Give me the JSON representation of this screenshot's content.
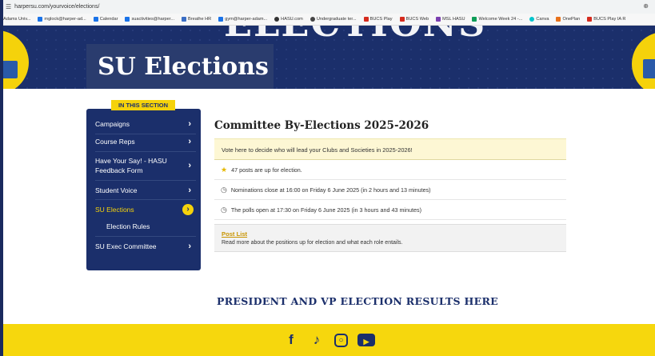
{
  "browser": {
    "url": "harpersu.com/yourvoice/elections/",
    "bookmarks": [
      {
        "label": "Adams Univ...",
        "color": "#1b5fa8"
      },
      {
        "label": "mglock@harper-ad...",
        "color": "#1a73e8"
      },
      {
        "label": "Calendar",
        "color": "#1a73e8"
      },
      {
        "label": "suactivities@harper...",
        "color": "#1a73e8"
      },
      {
        "label": "Breathe HR",
        "color": "#3b6ec4"
      },
      {
        "label": "gym@harper-adam...",
        "color": "#1a73e8"
      },
      {
        "label": "HASU.com",
        "color": "#333333"
      },
      {
        "label": "Undergraduate ter...",
        "color": "#444444"
      },
      {
        "label": "BUCS Play",
        "color": "#d52b1e"
      },
      {
        "label": "BUCS Web",
        "color": "#d52b1e"
      },
      {
        "label": "MSL HASU",
        "color": "#7a3fb0"
      },
      {
        "label": "Welcome Week 24 -...",
        "color": "#0f9d58"
      },
      {
        "label": "Canva",
        "color": "#00c4cc"
      },
      {
        "label": "OnePlan",
        "color": "#e8711a"
      },
      {
        "label": "BUCS Play IA R",
        "color": "#d52b1e"
      }
    ]
  },
  "banner": {
    "page_title": "SU Elections",
    "background_word": "ELECTIONS"
  },
  "sidebar": {
    "heading": "IN THIS SECTION",
    "items": [
      {
        "label": "Campaigns"
      },
      {
        "label": "Course Reps"
      },
      {
        "label": "Have Your Say! - HASU"
      },
      {
        "label": "Feedback Form"
      },
      {
        "label": "Student Voice"
      },
      {
        "label": "SU Elections"
      },
      {
        "label": "Election Rules"
      },
      {
        "label": "SU Exec Committee"
      }
    ]
  },
  "main": {
    "heading": "Committee By-Elections 2025-2026",
    "notice": "Vote here to decide who will lead your Clubs and Societies in 2025-2026!",
    "info": [
      {
        "icon": "star-icon",
        "text": "47 posts are up for election."
      },
      {
        "icon": "clock-icon",
        "text": "Nominations close at 16:00 on Friday 6 June 2025 (in 2 hours and 13 minutes)"
      },
      {
        "icon": "clock-icon",
        "text": "The polls open at 17:30 on Friday 6 June 2025 (in 3 hours and 43 minutes)"
      }
    ],
    "post_list": {
      "title": "Post List",
      "description": "Read more about the positions up for election and what each role entails."
    },
    "results_heading": "PRESIDENT AND VP ELECTION RESULTS HERE"
  },
  "footer": {
    "social": [
      "facebook-icon",
      "tiktok-icon",
      "instagram-icon",
      "youtube-icon"
    ]
  },
  "colors": {
    "navy": "#1b2f6b",
    "yellow": "#f5d20b",
    "notice_bg": "#fdf7d4",
    "link_gold": "#c89400"
  }
}
